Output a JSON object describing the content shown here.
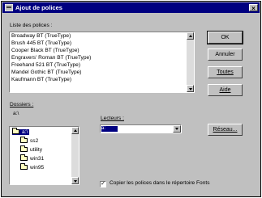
{
  "window": {
    "title": "Ajout de polices",
    "close_glyph": "×"
  },
  "font_list": {
    "label": "Liste des polices :",
    "items": [
      "Broadway BT (TrueType)",
      "Brush 445 BT (TrueType)",
      "Cooper Black BT (TrueType)",
      "Engravers' Roman BT (TrueType)",
      "Freehand 521 BT (TrueType)",
      "Mandel Gothic BT (TrueType)",
      "Kaufmann BT (TrueType)"
    ]
  },
  "buttons": {
    "ok": "OK",
    "cancel": "Annuler",
    "all": "Toutes",
    "help": "Aide",
    "network": "Réseau..."
  },
  "directories": {
    "label": "Dossiers :",
    "current_path": "a:\\",
    "items": [
      "a:\\",
      "ss2",
      "utility",
      "win31",
      "win95"
    ]
  },
  "drives": {
    "label": "Lecteurs :",
    "selected": "a:"
  },
  "copy_option": {
    "label": "Copier les polices dans le répertoire Fonts",
    "checked": true,
    "check_glyph": "✓"
  }
}
